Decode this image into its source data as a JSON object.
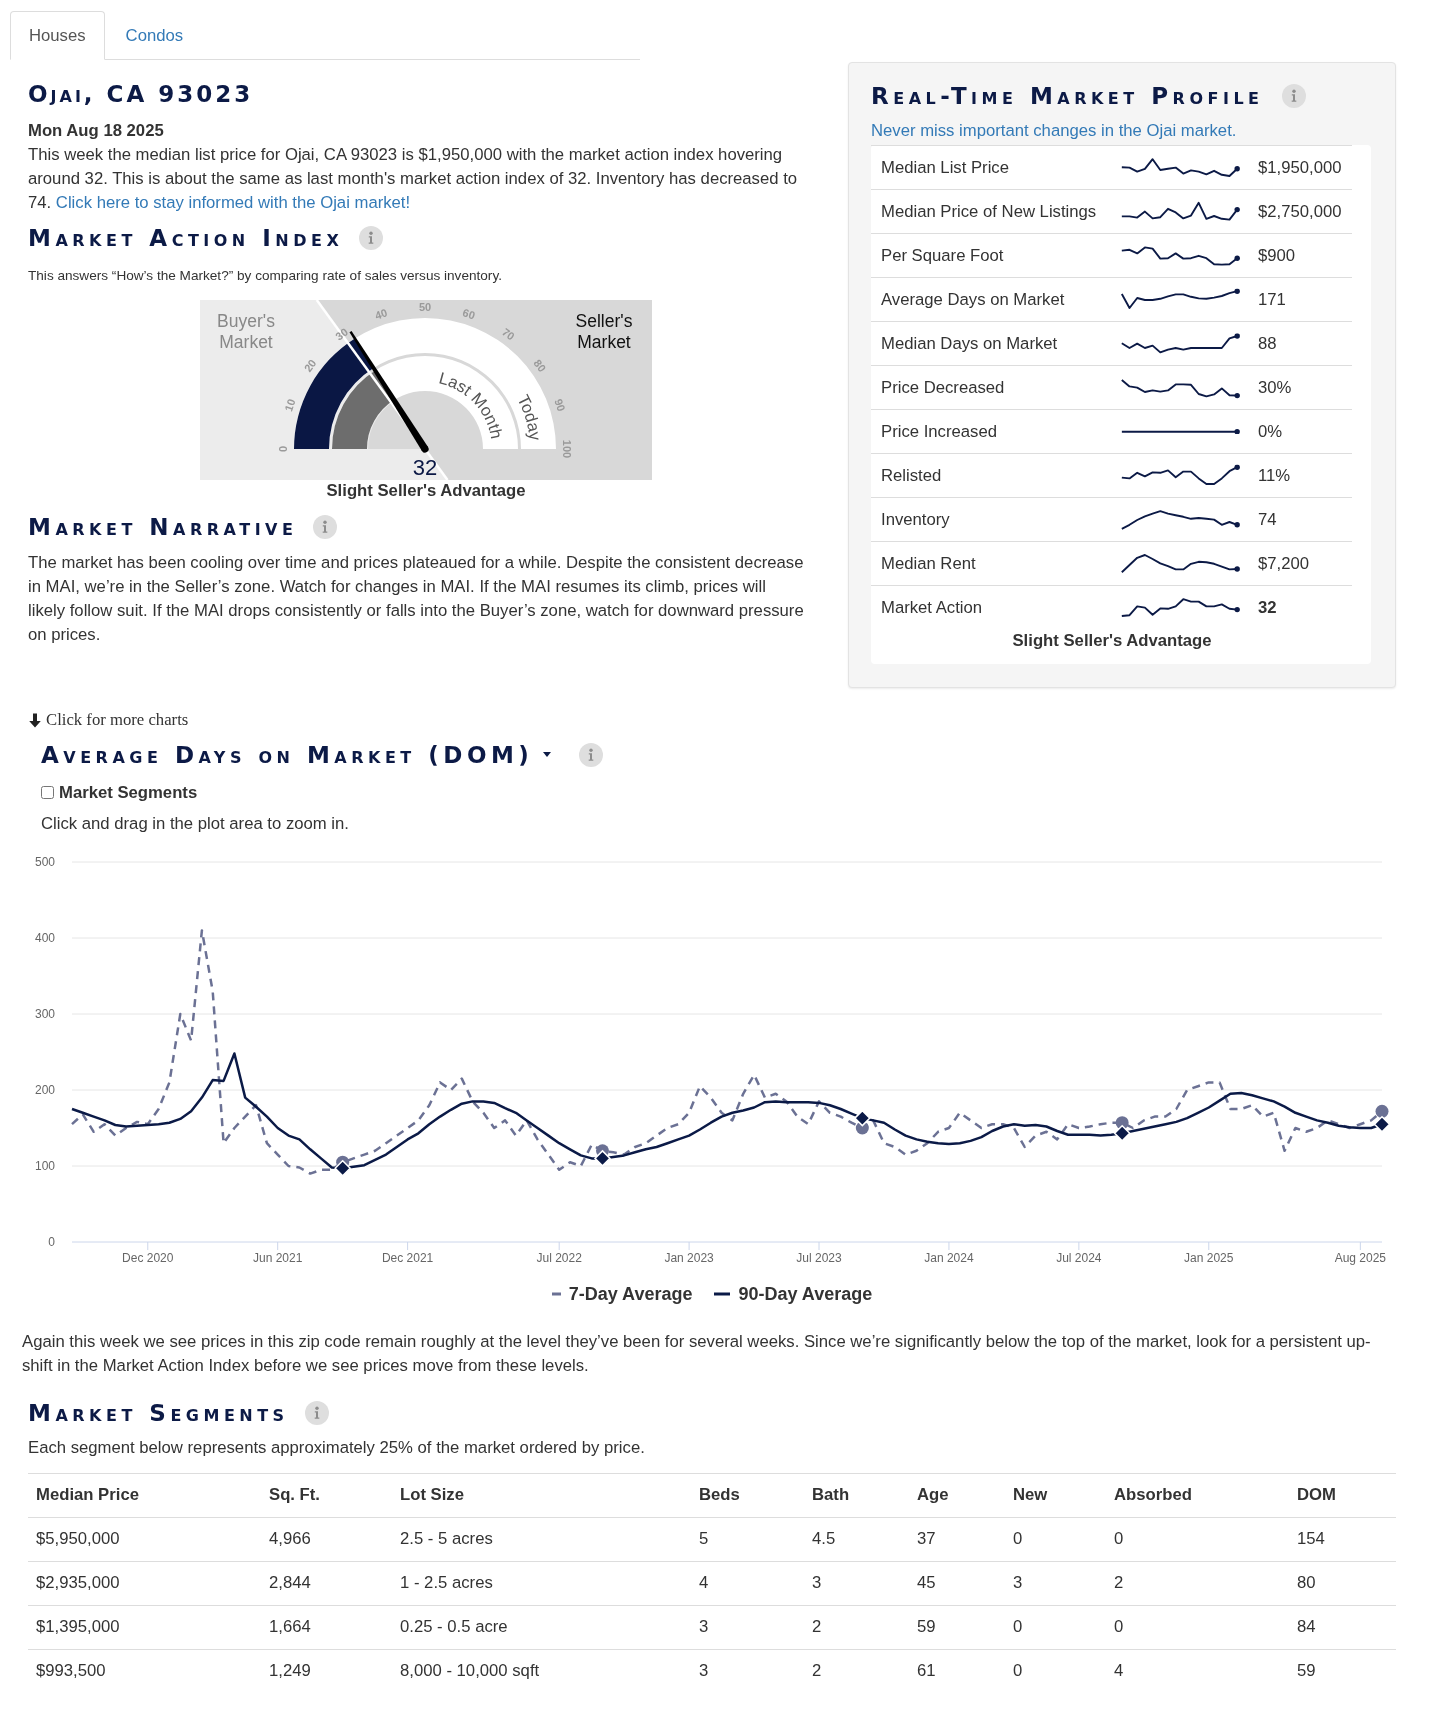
{
  "tabs": [
    {
      "label": "Houses",
      "selected": true
    },
    {
      "label": "Condos",
      "selected": false
    }
  ],
  "title": "Ojai, CA 93023",
  "summary": {
    "date": "Mon Aug 18 2025",
    "text": "This week the median list price for Ojai, CA 93023 is $1,950,000 with the market action index hovering around 32. This is about the same as last month's market action index of 32. Inventory has decreased to 74.",
    "link": "Click here to stay informed with the Ojai market!"
  },
  "market_action_index": {
    "title": "Market Action Index",
    "subtitle": "This answers “How’s the Market?” by comparing rate of sales versus inventory.",
    "gauge": {
      "buyers_label": "Buyer's Market",
      "sellers_label": "Seller's Market",
      "scale": [
        "0",
        "10",
        "20",
        "30",
        "40",
        "50",
        "60",
        "70",
        "80",
        "90",
        "100"
      ],
      "today": {
        "label": "Today",
        "level": 0.32
      },
      "last_month": {
        "label": "Last Month",
        "level": 0.32
      },
      "value": "32",
      "caption": "Slight Seller's Advantage"
    }
  },
  "market_narrative": {
    "title": "Market Narrative",
    "text": "The market has been cooling over time and prices plateaued for a while. Despite the consistent decrease in MAI, we’re in the Seller’s zone. Watch for changes in MAI. If the MAI resumes its climb, prices will likely follow suit. If the MAI drops consistently or falls into the Buyer’s zone, watch for downward pressure on prices."
  },
  "market_profile": {
    "title": "Real-Time Market Profile",
    "link": "Never miss important changes in the Ojai market.",
    "rows": [
      {
        "label": "Median List Price",
        "value": "$1,950,000",
        "emphasized": false
      },
      {
        "label": "Median Price of New Listings",
        "value": "$2,750,000",
        "emphasized": false
      },
      {
        "label": "Per Square Foot",
        "value": "$900",
        "emphasized": false
      },
      {
        "label": "Average Days on Market",
        "value": "171",
        "emphasized": false
      },
      {
        "label": "Median Days on Market",
        "value": "88",
        "emphasized": false
      },
      {
        "label": "Price Decreased",
        "value": "30%",
        "emphasized": false
      },
      {
        "label": "Price Increased",
        "value": "0%",
        "emphasized": false
      },
      {
        "label": "Relisted",
        "value": "11%",
        "emphasized": false
      },
      {
        "label": "Inventory",
        "value": "74",
        "emphasized": false
      },
      {
        "label": "Median Rent",
        "value": "$7,200",
        "emphasized": false
      },
      {
        "label": "Market Action",
        "value": "32",
        "emphasized": true
      }
    ],
    "caption": "Slight Seller's Advantage"
  },
  "charts_link": "Click for more charts",
  "dom_chart": {
    "title": "Average Days on Market (DOM)",
    "segments_toggle": {
      "label": "Market Segments",
      "checked": false
    },
    "hint": "Click and drag in the plot area to zoom in.",
    "chart_data": {
      "type": "line",
      "categories": [
        null,
        null,
        null,
        null,
        null,
        null,
        null,
        "Dec 2020",
        null,
        null,
        null,
        null,
        null,
        null,
        null,
        null,
        null,
        null,
        null,
        "Jun 2021",
        null,
        null,
        null,
        null,
        null,
        null,
        null,
        null,
        null,
        null,
        null,
        "Dec 2021",
        null,
        null,
        null,
        null,
        null,
        null,
        null,
        null,
        null,
        null,
        null,
        null,
        null,
        "Jul 2022",
        null,
        null,
        null,
        null,
        null,
        null,
        null,
        null,
        null,
        null,
        null,
        "Jan 2023",
        null,
        null,
        null,
        null,
        null,
        null,
        null,
        null,
        null,
        null,
        null,
        "Jul 2023",
        null,
        null,
        null,
        null,
        null,
        null,
        null,
        null,
        null,
        null,
        null,
        "Jan 2024",
        null,
        null,
        null,
        null,
        null,
        null,
        null,
        null,
        null,
        null,
        null,
        "Jul 2024",
        null,
        null,
        null,
        null,
        null,
        null,
        null,
        null,
        null,
        null,
        null,
        "Jan 2025",
        null,
        null,
        null,
        null,
        null,
        null,
        null,
        null,
        null,
        null,
        null,
        null,
        null,
        "Aug 2025",
        null,
        null
      ],
      "series": [
        {
          "name": "7-Day Average",
          "color": "#6b7194",
          "line_style": "dashed",
          "values": [
            155,
            168,
            145,
            155,
            140,
            150,
            158,
            155,
            175,
            210,
            300,
            265,
            410,
            330,
            130,
            150,
            165,
            180,
            130,
            115,
            100,
            98,
            90,
            95,
            95,
            105,
            110,
            115,
            120,
            130,
            140,
            150,
            160,
            180,
            210,
            200,
            215,
            185,
            170,
            150,
            160,
            140,
            160,
            135,
            115,
            95,
            105,
            100,
            128,
            120,
            118,
            115,
            125,
            130,
            140,
            150,
            155,
            170,
            205,
            190,
            170,
            160,
            195,
            220,
            190,
            195,
            185,
            165,
            155,
            185,
            170,
            165,
            157,
            150,
            160,
            130,
            125,
            115,
            120,
            130,
            145,
            150,
            170,
            160,
            150,
            155,
            155,
            150,
            125,
            140,
            145,
            135,
            155,
            150,
            152,
            155,
            157,
            157,
            150,
            160,
            165,
            165,
            175,
            200,
            205,
            210,
            210,
            175,
            175,
            180,
            165,
            170,
            120,
            150,
            145,
            150,
            160,
            155,
            150,
            155,
            160,
            172
          ]
        },
        {
          "name": "90-Day Average",
          "color": "#0b1a47",
          "line_style": "solid",
          "values": [
            175,
            170,
            165,
            160,
            154,
            152,
            153,
            154,
            155,
            157,
            162,
            172,
            190,
            213,
            212,
            248,
            190,
            178,
            165,
            150,
            140,
            135,
            122,
            110,
            98,
            97,
            99,
            101,
            108,
            115,
            125,
            135,
            143,
            155,
            165,
            174,
            182,
            185,
            185,
            183,
            176,
            170,
            160,
            150,
            140,
            130,
            122,
            114,
            110,
            110,
            112,
            114,
            118,
            122,
            125,
            130,
            135,
            140,
            148,
            157,
            165,
            170,
            173,
            177,
            184,
            185,
            184,
            184,
            184,
            183,
            180,
            175,
            169,
            163,
            160,
            157,
            148,
            140,
            135,
            132,
            130,
            129,
            130,
            133,
            138,
            146,
            152,
            155,
            153,
            154,
            152,
            146,
            141,
            141,
            141,
            140,
            141,
            143,
            146,
            149,
            152,
            155,
            158,
            163,
            170,
            177,
            186,
            195,
            196,
            193,
            189,
            185,
            178,
            170,
            165,
            160,
            157,
            153,
            151,
            150,
            150,
            155
          ]
        }
      ],
      "ylim": [
        0,
        500
      ],
      "yticks": [
        {
          "value": 0,
          "label": "0"
        },
        {
          "value": 100,
          "label": "100"
        },
        {
          "value": 200,
          "label": "200"
        },
        {
          "value": 300,
          "label": "300"
        },
        {
          "value": 400,
          "label": "400"
        },
        {
          "value": 500,
          "label": "500"
        }
      ],
      "grid": true,
      "legend": true
    }
  },
  "commentary": "Again this week we see prices in this zip code remain roughly at the level they’ve been for several weeks. Since we’re significantly below the top of the market, look for a persistent up-shift in the Market Action Index before we see prices move from these levels.",
  "market_segments": {
    "title": "Market Segments",
    "subtitle": "Each segment below represents approximately 25% of the market ordered by price.",
    "columns": [
      "Median Price",
      "Sq. Ft.",
      "Lot Size",
      "Beds",
      "Bath",
      "Age",
      "New",
      "Absorbed",
      "DOM"
    ],
    "rows": [
      [
        "$5,950,000",
        "4,966",
        "2.5 - 5 acres",
        "5",
        "4.5",
        "37",
        "0",
        "0",
        "154"
      ],
      [
        "$2,935,000",
        "2,844",
        "1 - 2.5 acres",
        "4",
        "3",
        "45",
        "3",
        "2",
        "80"
      ],
      [
        "$1,395,000",
        "1,664",
        "0.25 - 0.5 acre",
        "3",
        "2",
        "59",
        "0",
        "0",
        "84"
      ],
      [
        "$993,500",
        "1,249",
        "8,000 - 10,000 sqft",
        "3",
        "2",
        "61",
        "0",
        "4",
        "59"
      ]
    ]
  }
}
